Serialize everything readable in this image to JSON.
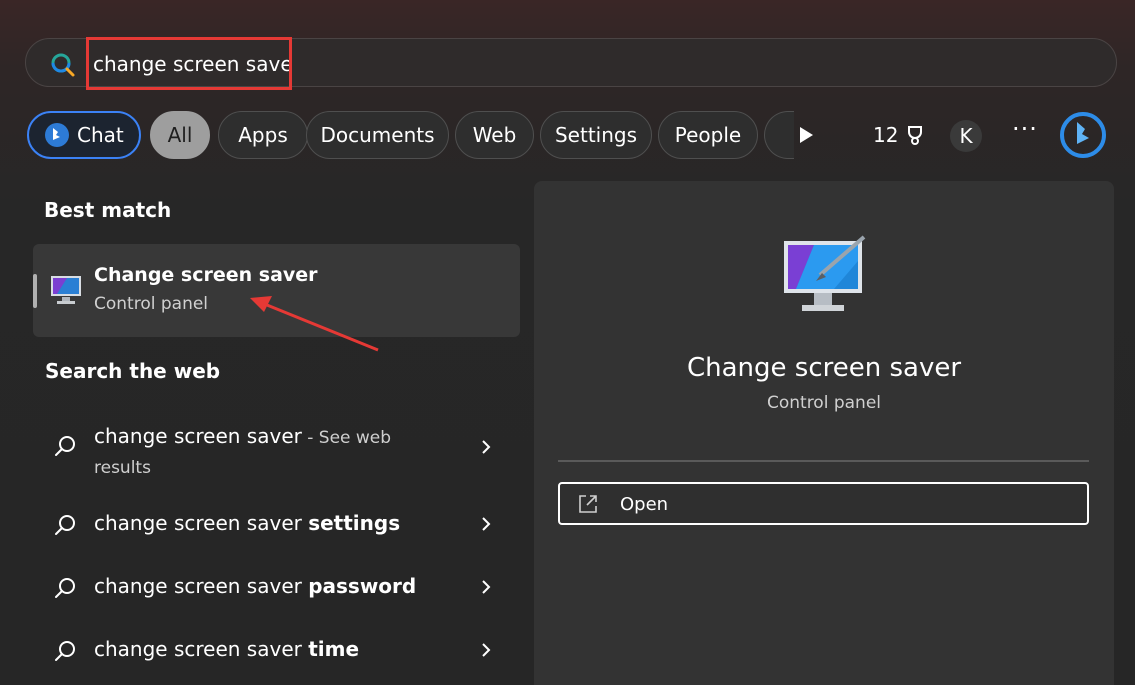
{
  "search": {
    "query": "change screen saver",
    "placeholder": ""
  },
  "chips": {
    "chat": "Chat",
    "all": "All",
    "apps": "Apps",
    "documents": "Documents",
    "web": "Web",
    "settings": "Settings",
    "people": "People",
    "points": "12",
    "avatar_initial": "K",
    "more": "···"
  },
  "best_match": {
    "title": "Best match",
    "item_name": "Change screen saver",
    "item_sub": "Control panel"
  },
  "web": {
    "title": "Search the web",
    "items": [
      {
        "prefix": "change screen saver",
        "bold": "",
        "suffix": " - See web",
        "suffix2": "results"
      },
      {
        "prefix": "change screen saver ",
        "bold": "settings"
      },
      {
        "prefix": "change screen saver ",
        "bold": "password"
      },
      {
        "prefix": "change screen saver ",
        "bold": "time"
      }
    ]
  },
  "preview": {
    "title": "Change screen saver",
    "subtitle": "Control panel",
    "open_label": "Open"
  },
  "colors": {
    "accent_blue": "#3b82f6",
    "highlight_red": "#e53935",
    "selected_chip": "#9e9e9e"
  }
}
